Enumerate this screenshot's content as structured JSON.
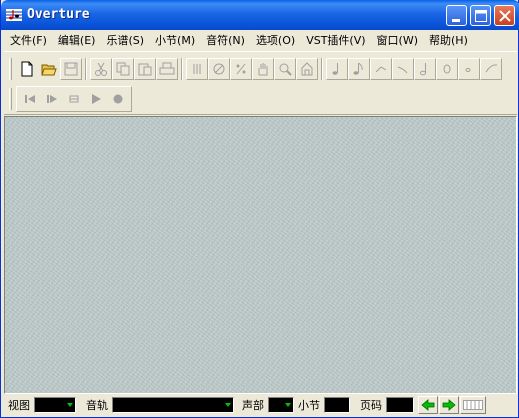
{
  "window": {
    "title": "Overture",
    "icon": "music-note-app-icon",
    "controls": [
      "minimize-icon",
      "maximize-icon",
      "close-icon"
    ]
  },
  "menu": [
    {
      "label": "文件(F)"
    },
    {
      "label": "编辑(E)"
    },
    {
      "label": "乐谱(S)"
    },
    {
      "label": "小节(M)"
    },
    {
      "label": "音符(N)"
    },
    {
      "label": "选项(O)"
    },
    {
      "label": "VST插件(V)"
    },
    {
      "label": "窗口(W)"
    },
    {
      "label": "帮助(H)"
    }
  ],
  "toolbar_main": {
    "file": [
      "new-file-icon",
      "open-folder-icon",
      "save-disk-icon"
    ],
    "edit": [
      "cut-icon",
      "copy-icon",
      "paste-icon",
      "print-icon"
    ],
    "tools": [
      "fermata-tool-icon",
      "erase-tool-icon",
      "percent-tool-icon",
      "hand-tool-icon",
      "zoom-tool-icon",
      "keyboard-tool-icon"
    ],
    "notes": [
      "quarter-note-icon",
      "eighth-note-icon",
      "grace-note-icon",
      "slur-icon",
      "half-note-icon",
      "whole-note-icon",
      "dotted-note-icon",
      "tie-icon"
    ]
  },
  "toolbar_transport": [
    "rewind-icon",
    "play-from-start-icon",
    "step-icon",
    "play-icon",
    "stop-icon"
  ],
  "status": {
    "view_label": "视图",
    "track_label": "音轨",
    "voice_label": "声部",
    "measure_label": "小节",
    "page_label": "页码"
  },
  "colors": {
    "titlebar": "#0A5FE6",
    "workspace": "#B9C6C6",
    "chrome": "#ECE9D8",
    "nav_arrow": "#00C000"
  }
}
